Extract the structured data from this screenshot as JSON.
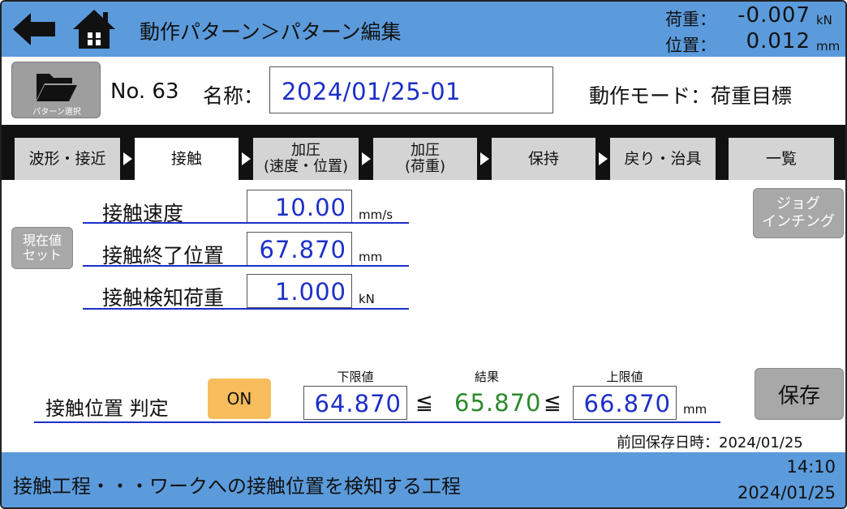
{
  "header": {
    "title": "動作パターン＞パターン編集",
    "load_label": "荷重：",
    "load_value": "-0.007",
    "load_unit": "kN",
    "position_label": "位置：",
    "position_value": "0.012",
    "position_unit": "mm",
    "back_icon": "back-arrow-icon",
    "home_icon": "home-icon"
  },
  "pattern": {
    "select_label": "パターン選択",
    "number": "No. 63",
    "name_label": "名称：",
    "name_value": "2024/01/25-01",
    "mode": "動作モード：荷重目標"
  },
  "tabs": [
    {
      "label": "波形・接近"
    },
    {
      "label": "接触"
    },
    {
      "label": "加圧\n(速度・位置)"
    },
    {
      "label": "加圧\n(荷重)"
    },
    {
      "label": "保持"
    },
    {
      "label": "戻り・治具"
    },
    {
      "label": "一覧"
    }
  ],
  "form": {
    "set_current_label": "現在値\nセット",
    "jog_label": "ジョグ\nインチング",
    "rows": [
      {
        "label": "接触速度",
        "value": "10.00",
        "unit": "mm/s"
      },
      {
        "label": "接触終了位置",
        "value": "67.870",
        "unit": "mm"
      },
      {
        "label": "接触検知荷重",
        "value": "1.000",
        "unit": "kN"
      }
    ]
  },
  "judgement": {
    "label": "接触位置 判定",
    "toggle": "ON",
    "lower_label": "下限値",
    "result_label": "結果",
    "upper_label": "上限値",
    "lower_value": "64.870",
    "result_value": "65.870",
    "upper_value": "66.870",
    "leq": "≦",
    "unit": "mm",
    "save_label": "保存",
    "last_saved": "前回保存日時：2024/01/25"
  },
  "footer": {
    "description": "接触工程・・・ワークへの接触位置を検知する工程",
    "time": "14:10",
    "date": "2024/01/25"
  },
  "colors": {
    "header_bg": "#5b9bdc",
    "value_blue": "#1c2fc7",
    "result_green": "#2a8a2a",
    "toggle_on": "#f7bd5c",
    "button_gray": "#a8a8a8"
  }
}
